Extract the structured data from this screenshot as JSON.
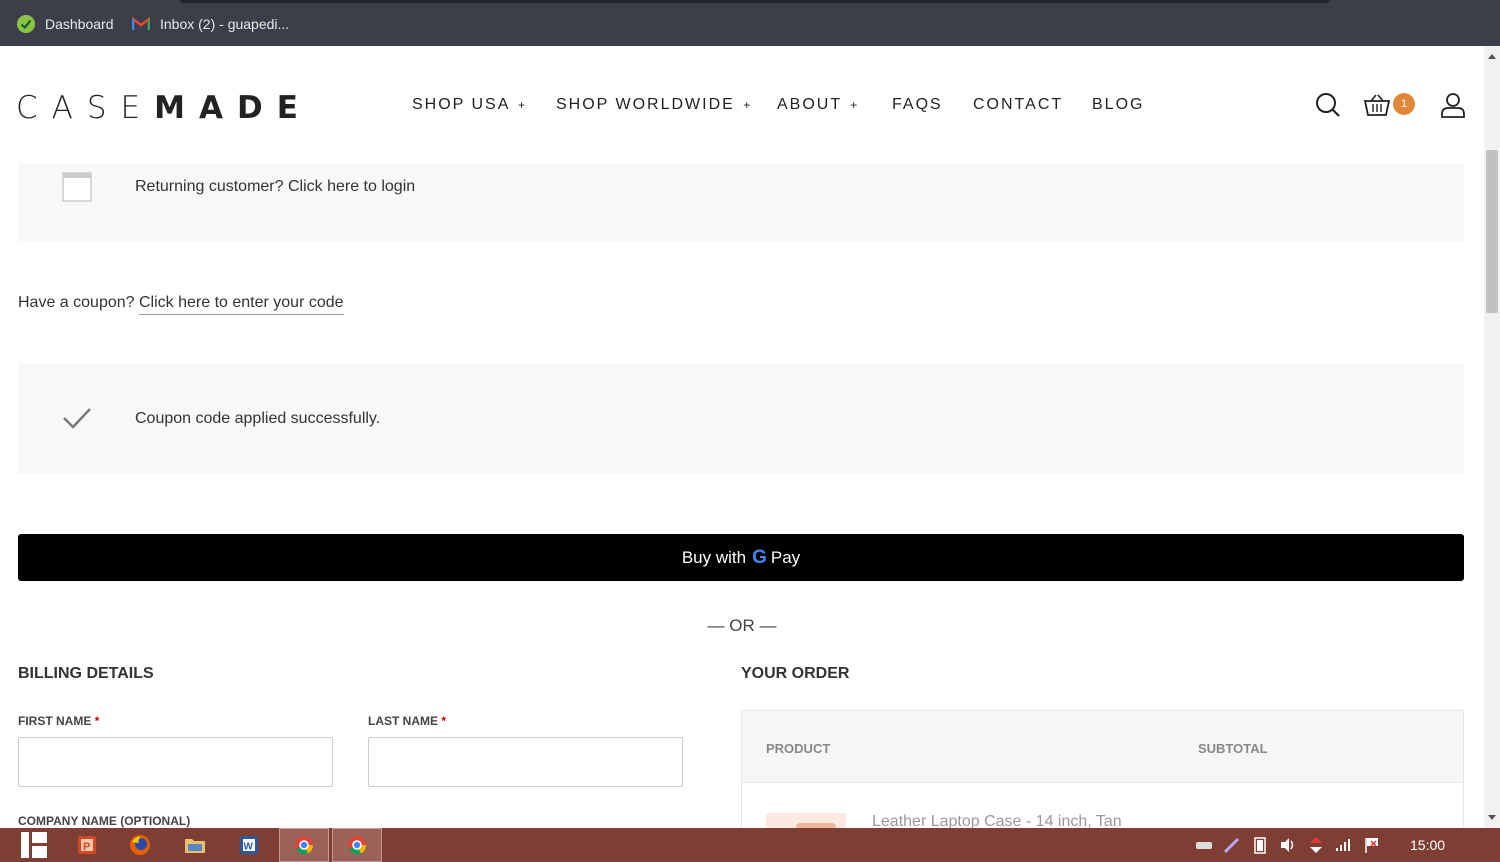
{
  "bookmarks": [
    {
      "label": "Dashboard",
      "icon": "dashboard-check-icon"
    },
    {
      "label": "Inbox (2) - guapedi...",
      "icon": "gmail-icon"
    }
  ],
  "header": {
    "logo_light": "CASE",
    "logo_bold": "MADE",
    "nav": [
      {
        "label": "SHOP USA",
        "plus": "+"
      },
      {
        "label": "SHOP WORLDWIDE",
        "plus": "+"
      },
      {
        "label": "ABOUT",
        "plus": "+"
      },
      {
        "label": "FAQS",
        "plus": ""
      },
      {
        "label": "CONTACT",
        "plus": ""
      },
      {
        "label": "BLOG",
        "plus": ""
      }
    ],
    "cart_count": "1",
    "badge_color": "#e2873a"
  },
  "notices": {
    "returning_prefix": "Returning customer?",
    "returning_link": "Click here to login",
    "coupon_prefix": "Have a coupon?",
    "coupon_link": "Click here to enter your code",
    "coupon_applied": "Coupon code applied successfully."
  },
  "gpay": {
    "prefix": "Buy with",
    "g": "G",
    "pay": "Pay"
  },
  "or_separator": "— OR —",
  "billing": {
    "title": "BILLING DETAILS",
    "first_name_label": "FIRST NAME",
    "last_name_label": "LAST NAME",
    "required_mark": "*",
    "first_name_value": "",
    "last_name_value": "",
    "company_label": "COMPANY NAME (OPTIONAL)"
  },
  "order": {
    "title": "YOUR ORDER",
    "col_product": "PRODUCT",
    "col_subtotal": "SUBTOTAL",
    "item_name": "Leather Laptop Case - 14 inch, Tan"
  },
  "taskbar": {
    "apps": [
      "start-icon",
      "powerpoint-icon",
      "firefox-icon",
      "file-explorer-icon",
      "word-icon",
      "chrome-icon",
      "chrome-icon"
    ],
    "tray": [
      "drive-icon",
      "pen-icon",
      "battery-icon",
      "volume-icon",
      "network-arrows-icon",
      "signal-icon",
      "flag-icon"
    ],
    "time": "15:00"
  }
}
